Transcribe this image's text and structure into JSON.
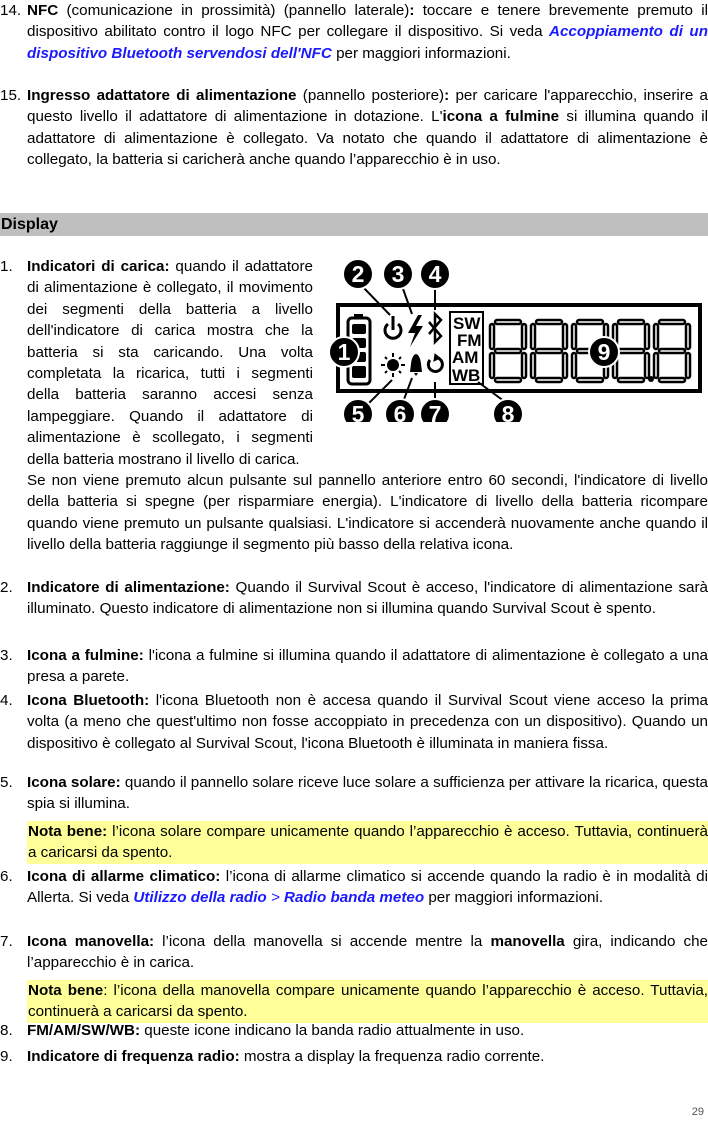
{
  "page_number": "29",
  "colors": {
    "link": "#1a1aff",
    "section_bar": "#bfbfbf",
    "note_highlight": "#ffff99"
  },
  "intro_items": [
    {
      "number": "14.",
      "title": "NFC",
      "text_a": " (comunicazione in prossimità) (pannello laterale)",
      "colon": ":",
      "text_b": " toccare e tenere brevemente premuto il dispositivo abilitato contro il logo NFC per collegare il dispositivo. Si veda ",
      "link": "Accoppiamento di un dispositivo Bluetooth servendosi dell'NFC",
      "text_c": " per maggiori informazioni."
    },
    {
      "number": "15.",
      "title": "Ingresso adattatore di alimentazione",
      "text_a": " (pannello posteriore)",
      "colon": ":",
      "text_b": " per caricare l'apparecchio, inserire a questo livello il adattatore di alimentazione in dotazione. L'",
      "bold_inline": "icona a fulmine",
      "text_c": " si illumina quando il adattatore di alimentazione è collegato. Va notato che quando il adattatore di alimentazione è collegato, la batteria si caricherà anche quando l’apparecchio è in uso."
    }
  ],
  "section": {
    "title": "Display"
  },
  "figure": {
    "callouts": [
      "1",
      "2",
      "3",
      "4",
      "5",
      "6",
      "7",
      "8",
      "9"
    ],
    "bands": [
      "SW",
      "FM",
      "AM",
      "WB"
    ],
    "icons": [
      "battery-icon",
      "power-icon",
      "lightning-icon",
      "bluetooth-icon",
      "sun-icon",
      "bell-icon",
      "crank-icon"
    ],
    "frequency_digits": "8888.8"
  },
  "display_items": [
    {
      "number": "1.",
      "title": "Indicatori di carica:",
      "text": " quando il adattatore di alimentazione è collegato, il movimento dei segmenti della batteria a livello dell'indicatore di carica mostra che la batteria si sta caricando. Una volta completata la ricarica, tutti i segmenti della batteria saranno accesi senza lampeggiare. Quando il adattatore di alimentazione è scollegato, i segmenti della batteria mostrano il livello di carica.",
      "extra": "Se non viene premuto alcun pulsante sul pannello anteriore entro 60 secondi, l'indicatore di livello della batteria si spegne (per risparmiare energia). L'indicatore di livello della batteria ricompare quando viene premuto un pulsante qualsiasi. L'indicatore si accenderà nuovamente anche quando il livello della batteria raggiunge il segmento più basso della relativa icona."
    },
    {
      "number": "2.",
      "title": "Indicatore di alimentazione:",
      "text": " Quando il Survival Scout è acceso, l'indicatore di alimentazione sarà illuminato. Questo indicatore di alimentazione non si illumina quando Survival Scout è spento."
    },
    {
      "number": "3.",
      "title": "Icona a fulmine:",
      "text": " l'icona a fulmine si illumina quando il adattatore di alimentazione è collegato a una presa a parete."
    },
    {
      "number": "4.",
      "title": "Icona Bluetooth:",
      "text": " l'icona Bluetooth non è accesa quando il Survival Scout viene acceso la prima volta (a meno che quest'ultimo non fosse accoppiato in precedenza con un dispositivo). Quando un dispositivo è collegato al Survival Scout, l'icona Bluetooth è illuminata in maniera fissa."
    },
    {
      "number": "5.",
      "title": "Icona solare:",
      "text": " quando il pannello solare riceve luce solare a sufficienza per attivare la ricarica, questa spia si illumina.",
      "note_label": "Nota bene:",
      "note_text": " l’icona solare compare unicamente quando l’apparecchio è acceso. Tuttavia, continuerà a caricarsi da spento."
    },
    {
      "number": "6.",
      "title": "Icona di allarme climatico:",
      "text_a": " l’icona di allarme climatico si accende quando la radio è in modalità di Allerta. Si veda ",
      "link_a": "Utilizzo della radio",
      "sep": " > ",
      "link_b": "Radio banda meteo",
      "text_b": " per maggiori informazioni."
    },
    {
      "number": "7.",
      "title": "Icona manovella:",
      "text_a": " l’icona della manovella si accende mentre la ",
      "bold_inline": "manovella",
      "text_b": " gira, indicando che l’apparecchio è in carica.",
      "note_label": "Nota bene",
      "note_text": ": l’icona della manovella compare unicamente quando l’apparecchio è acceso. Tuttavia, continuerà a caricarsi da spento."
    },
    {
      "number": "8.",
      "title": "FM/AM/SW/WB:",
      "text": " queste icone indicano la banda radio attualmente in uso."
    },
    {
      "number": "9.",
      "title": "Indicatore di frequenza radio:",
      "text": " mostra a display la frequenza radio corrente."
    }
  ]
}
